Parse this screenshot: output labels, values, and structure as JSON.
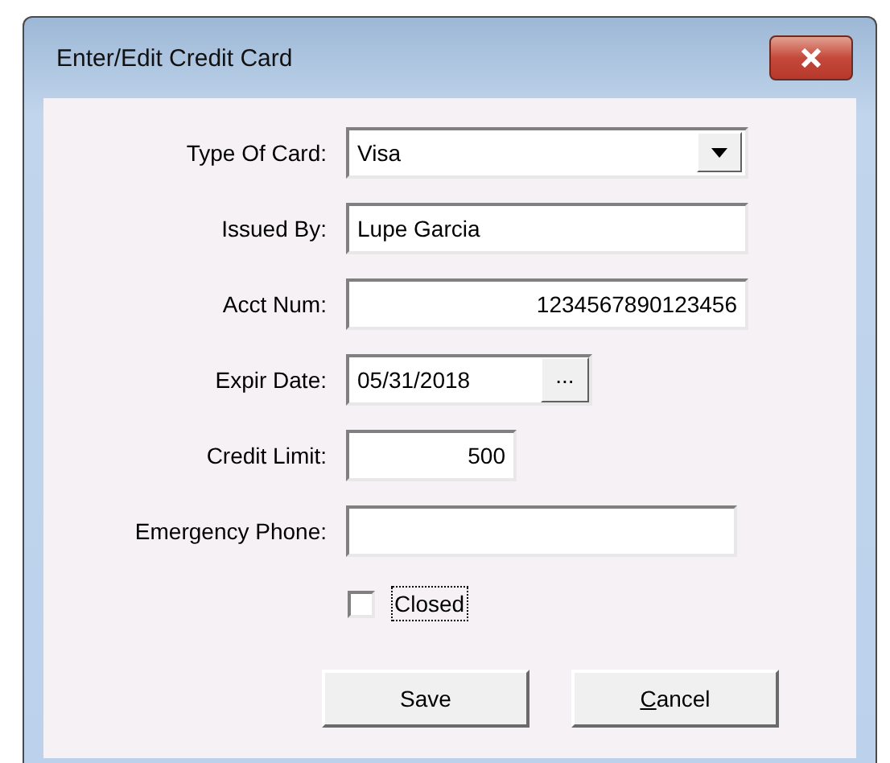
{
  "window": {
    "title": "Enter/Edit Credit Card"
  },
  "fields": [
    {
      "label": "Type Of Card:",
      "kind": "dropdown",
      "value": "Visa"
    },
    {
      "label": "Issued By:",
      "kind": "text",
      "value": "Lupe Garcia"
    },
    {
      "label": "Acct Num:",
      "kind": "number",
      "value": "1234567890123456"
    },
    {
      "label": "Expir Date:",
      "kind": "date",
      "value": "05/31/2018",
      "button": "..."
    },
    {
      "label": "Credit Limit:",
      "kind": "number",
      "value": "500"
    },
    {
      "label": "Emergency Phone:",
      "kind": "text"
    }
  ],
  "checkbox": {
    "label": "Closed",
    "checked": false,
    "focused": true
  },
  "buttons": [
    {
      "label": "Save",
      "first_letter_underlined": false
    },
    {
      "label": "Cancel",
      "first_letter_underlined": true
    }
  ]
}
